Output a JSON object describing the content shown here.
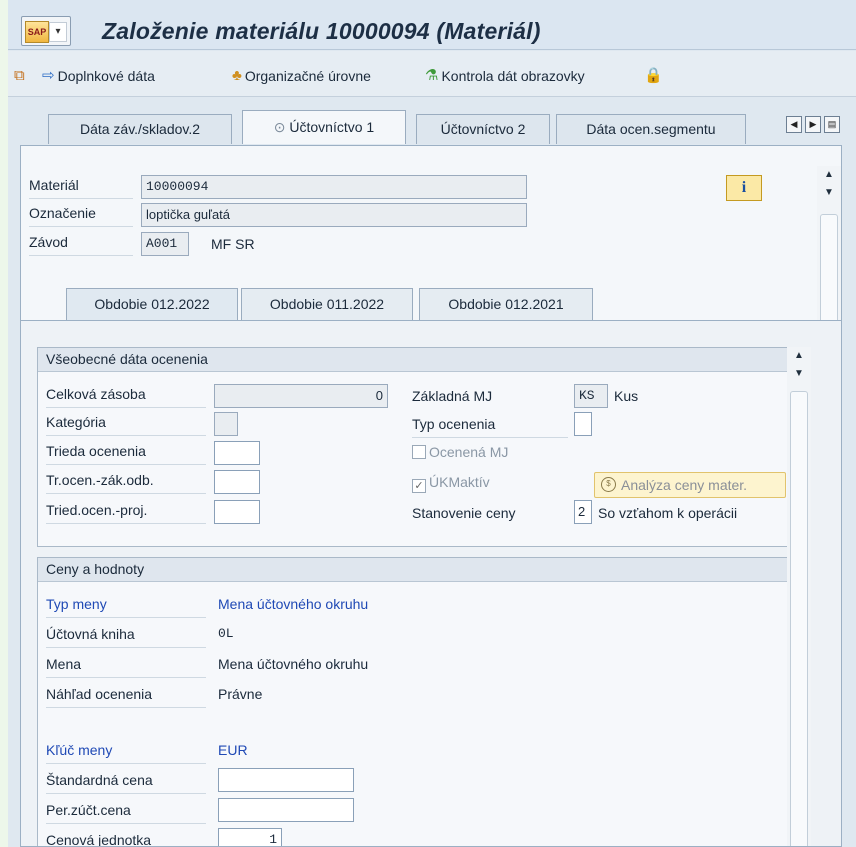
{
  "window": {
    "title": "Založenie materiálu 10000094 (Materiál)",
    "app_button_logo": "SAP"
  },
  "toolbar": {
    "extra_data": "Doplnkové dáta",
    "org_levels": "Organizačné úrovne",
    "check_screen": "Kontrola dát obrazovky"
  },
  "tabs": {
    "items": [
      {
        "label": "Dáta záv./skladov.2"
      },
      {
        "label": "Účtovníctvo 1",
        "active": true
      },
      {
        "label": "Účtovníctvo 2"
      },
      {
        "label": "Dáta ocen.segmentu"
      }
    ]
  },
  "header": {
    "material_label": "Materiál",
    "material_value": "10000094",
    "description_label": "Označenie",
    "description_value": "loptička guľatá",
    "plant_label": "Závod",
    "plant_code": "A001",
    "plant_name": "MF SR"
  },
  "subtabs": {
    "items": [
      {
        "label": "Obdobie 012.2022",
        "active": true
      },
      {
        "label": "Obdobie 011.2022"
      },
      {
        "label": "Obdobie 012.2021"
      }
    ]
  },
  "general": {
    "title": "Všeobecné dáta ocenenia",
    "total_stock_label": "Celková zásoba",
    "total_stock_value": "0",
    "category_label": "Kategória",
    "valuation_class_label": "Trieda ocenenia",
    "vc_sales_label": "Tr.ocen.-zák.odb.",
    "vc_project_label": "Tried.ocen.-proj.",
    "base_uom_label": "Základná MJ",
    "base_uom_code": "KS",
    "base_uom_text": "Kus",
    "valuation_type_label": "Typ ocenenia",
    "valuated_uom_label": "Ocenená MJ",
    "ml_active_label": "ÚKMaktív",
    "ml_active_check": "✓",
    "analyze_button": "Analýza ceny mater.",
    "price_det_label": "Stanovenie ceny",
    "price_det_value": "2",
    "price_det_text": "So vzťahom k operácii"
  },
  "prices": {
    "title": "Ceny a hodnoty",
    "currency_type_label": "Typ meny",
    "currency_type_value": "Mena účtovného okruhu",
    "ledger_label": "Účtovná kniha",
    "ledger_value": "0L",
    "currency_label": "Mena",
    "currency_value": "Mena účtovného okruhu",
    "valuation_view_label": "Náhľad ocenenia",
    "valuation_view_value": "Právne",
    "currency_key_label": "Kľúč meny",
    "currency_key_value": "EUR",
    "standard_price_label": "Štandardná cena",
    "periodic_price_label": "Per.zúčt.cena",
    "price_unit_label": "Cenová jednotka",
    "price_unit_value": "1"
  },
  "colors": {
    "accent_blue": "#1f49b5",
    "info_button": "#fbe9a6"
  }
}
